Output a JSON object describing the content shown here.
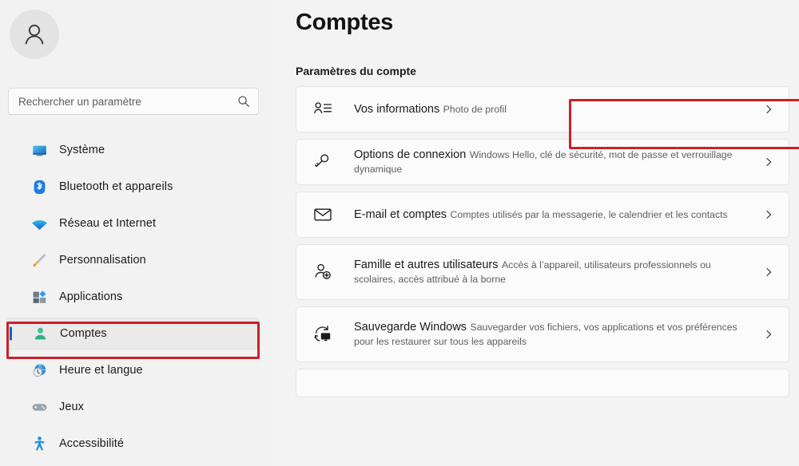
{
  "window": {
    "title": "Comptes"
  },
  "sidebar": {
    "avatar_icon": "person-avatar-icon",
    "search": {
      "placeholder": "Rechercher un paramètre",
      "value": "",
      "icon": "search-icon"
    },
    "items": [
      {
        "label": "Système",
        "icon": "monitor-icon",
        "selected": false
      },
      {
        "label": "Bluetooth et appareils",
        "icon": "bluetooth-icon",
        "selected": false
      },
      {
        "label": "Réseau et Internet",
        "icon": "wifi-icon",
        "selected": false
      },
      {
        "label": "Personnalisation",
        "icon": "paintbrush-icon",
        "selected": false
      },
      {
        "label": "Applications",
        "icon": "apps-icon",
        "selected": false
      },
      {
        "label": "Comptes",
        "icon": "person-icon",
        "selected": true
      },
      {
        "label": "Heure et langue",
        "icon": "clock-globe-icon",
        "selected": false
      },
      {
        "label": "Jeux",
        "icon": "gamepad-icon",
        "selected": false
      },
      {
        "label": "Accessibilité",
        "icon": "accessibility-icon",
        "selected": false
      }
    ]
  },
  "main": {
    "page_title": "Comptes",
    "section_title": "Paramètres du compte",
    "cards": [
      {
        "title": "Vos informations",
        "subtitle": "Photo de profil",
        "icon": "contact-card-icon",
        "chevron": "chevron-right-icon"
      },
      {
        "title": "Options de connexion",
        "subtitle": "Windows Hello, clé de sécurité, mot de passe et verrouillage dynamique",
        "icon": "key-icon",
        "chevron": "chevron-right-icon"
      },
      {
        "title": "E-mail et comptes",
        "subtitle": "Comptes utilisés par la messagerie, le calendrier et les contacts",
        "icon": "mail-icon",
        "chevron": "chevron-right-icon"
      },
      {
        "title": "Famille et autres utilisateurs",
        "subtitle": "Accès à l’appareil, utilisateurs professionnels ou scolaires, accès attribué à la borne",
        "icon": "add-user-icon",
        "chevron": "chevron-right-icon"
      },
      {
        "title": "Sauvegarde Windows",
        "subtitle": "Sauvegarder vos fichiers, vos applications et vos préférences pour les restaurer sur tous les appareils",
        "icon": "backup-sync-icon",
        "chevron": "chevron-right-icon"
      }
    ]
  },
  "annotations": {
    "color": "#cc1f28",
    "highlighted_sidebar_item": "Comptes",
    "highlighted_card": "Vos informations"
  },
  "colors": {
    "accent": "#0067c0",
    "sidebar_bg": "#f2f2f2",
    "main_bg": "#f3f3f3",
    "card_bg": "#fbfbfb",
    "annotation_red": "#cc1f28"
  }
}
